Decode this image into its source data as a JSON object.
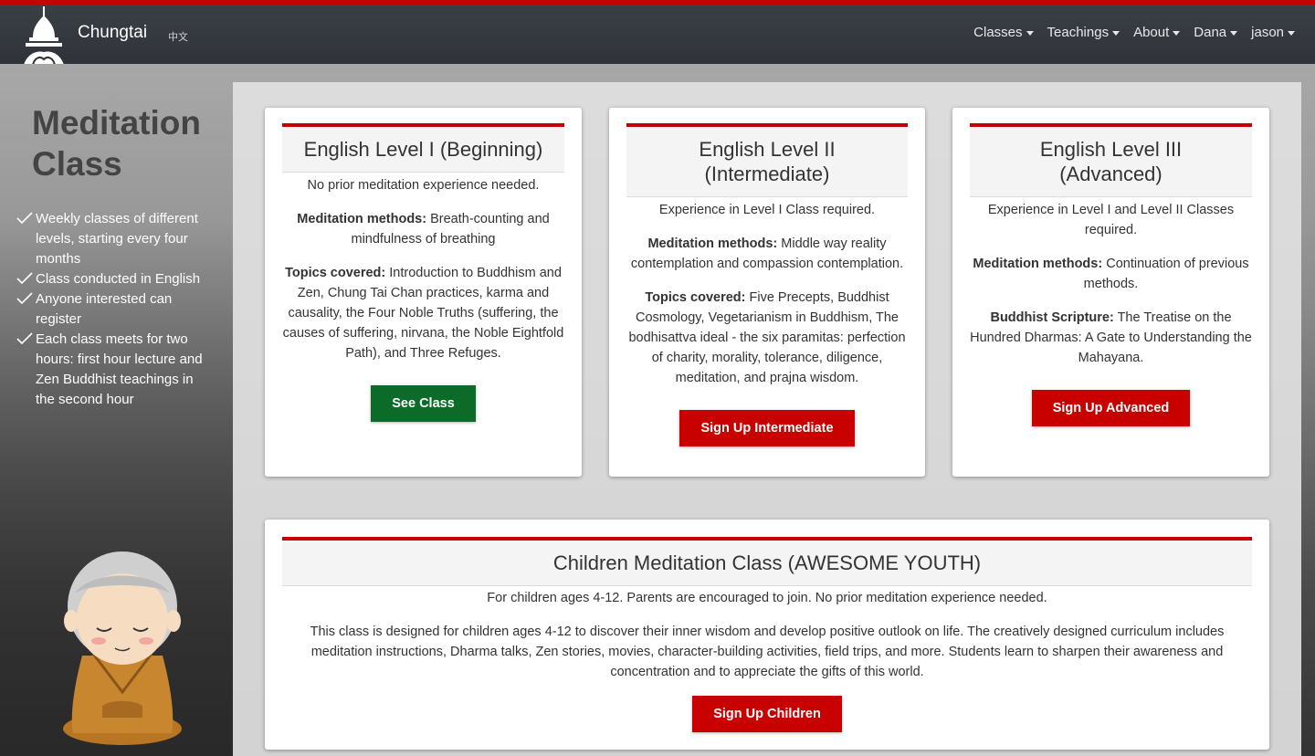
{
  "navbar": {
    "brand": "Chungtai",
    "lang": "中文",
    "items": [
      "Classes",
      "Teachings",
      "About",
      "Dana",
      "jason"
    ]
  },
  "sidebar": {
    "title": "Meditation Class",
    "points": [
      "Weekly classes of different levels, starting every four months",
      "Class conducted in English",
      "Anyone interested can register",
      "Each class meets for two hours: first hour lecture and Zen Buddhist teachings in the second hour"
    ]
  },
  "cards": {
    "level1": {
      "title": "English Level I (Beginning)",
      "req": "No prior meditation experience needed.",
      "methods_label": "Meditation methods:",
      "methods": " Breath-counting and mindfulness of breathing",
      "topics_label": "Topics covered:",
      "topics": " Introduction to Buddhism and Zen, Chung Tai Chan practices, karma and causality, the Four Noble Truths (suffering, the causes of suffering, nirvana, the Noble Eightfold Path), and Three Refuges.",
      "button": "See Class"
    },
    "level2": {
      "title": "English Level II (Intermediate)",
      "req": "Experience in Level I Class required.",
      "methods_label": "Meditation methods:",
      "methods": " Middle way reality contemplation and compassion contemplation.",
      "topics_label": "Topics covered:",
      "topics": " Five Precepts, Buddhist Cosmology, Vegetarianism in Buddhism, The bodhisattva ideal - the six paramitas: perfection of charity, morality, tolerance, diligence, meditation, and prajna wisdom.",
      "button": "Sign Up Intermediate"
    },
    "level3": {
      "title": "English Level III (Advanced)",
      "req": "Experience in Level I and Level II Classes required.",
      "methods_label": "Meditation methods:",
      "methods": " Continuation of previous methods.",
      "scripture_label": "Buddhist Scripture:",
      "scripture": " The Treatise on the Hundred Dharmas: A Gate to Understanding the Mahayana.",
      "button": "Sign Up Advanced"
    },
    "children": {
      "title": "Children Meditation Class (AWESOME YOUTH)",
      "req": "For children ages 4-12. Parents are encouraged to join. No prior meditation experience needed.",
      "desc": "This class is designed for children ages 4-12 to discover their inner wisdom and develop positive outlook on life. The creatively designed curriculum includes meditation instructions, Dharma talks, Zen stories, movies, character-building activities, field trips, and more. Students learn to sharpen their awareness and concentration and to appreciate the gifts of this world.",
      "button": "Sign Up Children"
    }
  }
}
